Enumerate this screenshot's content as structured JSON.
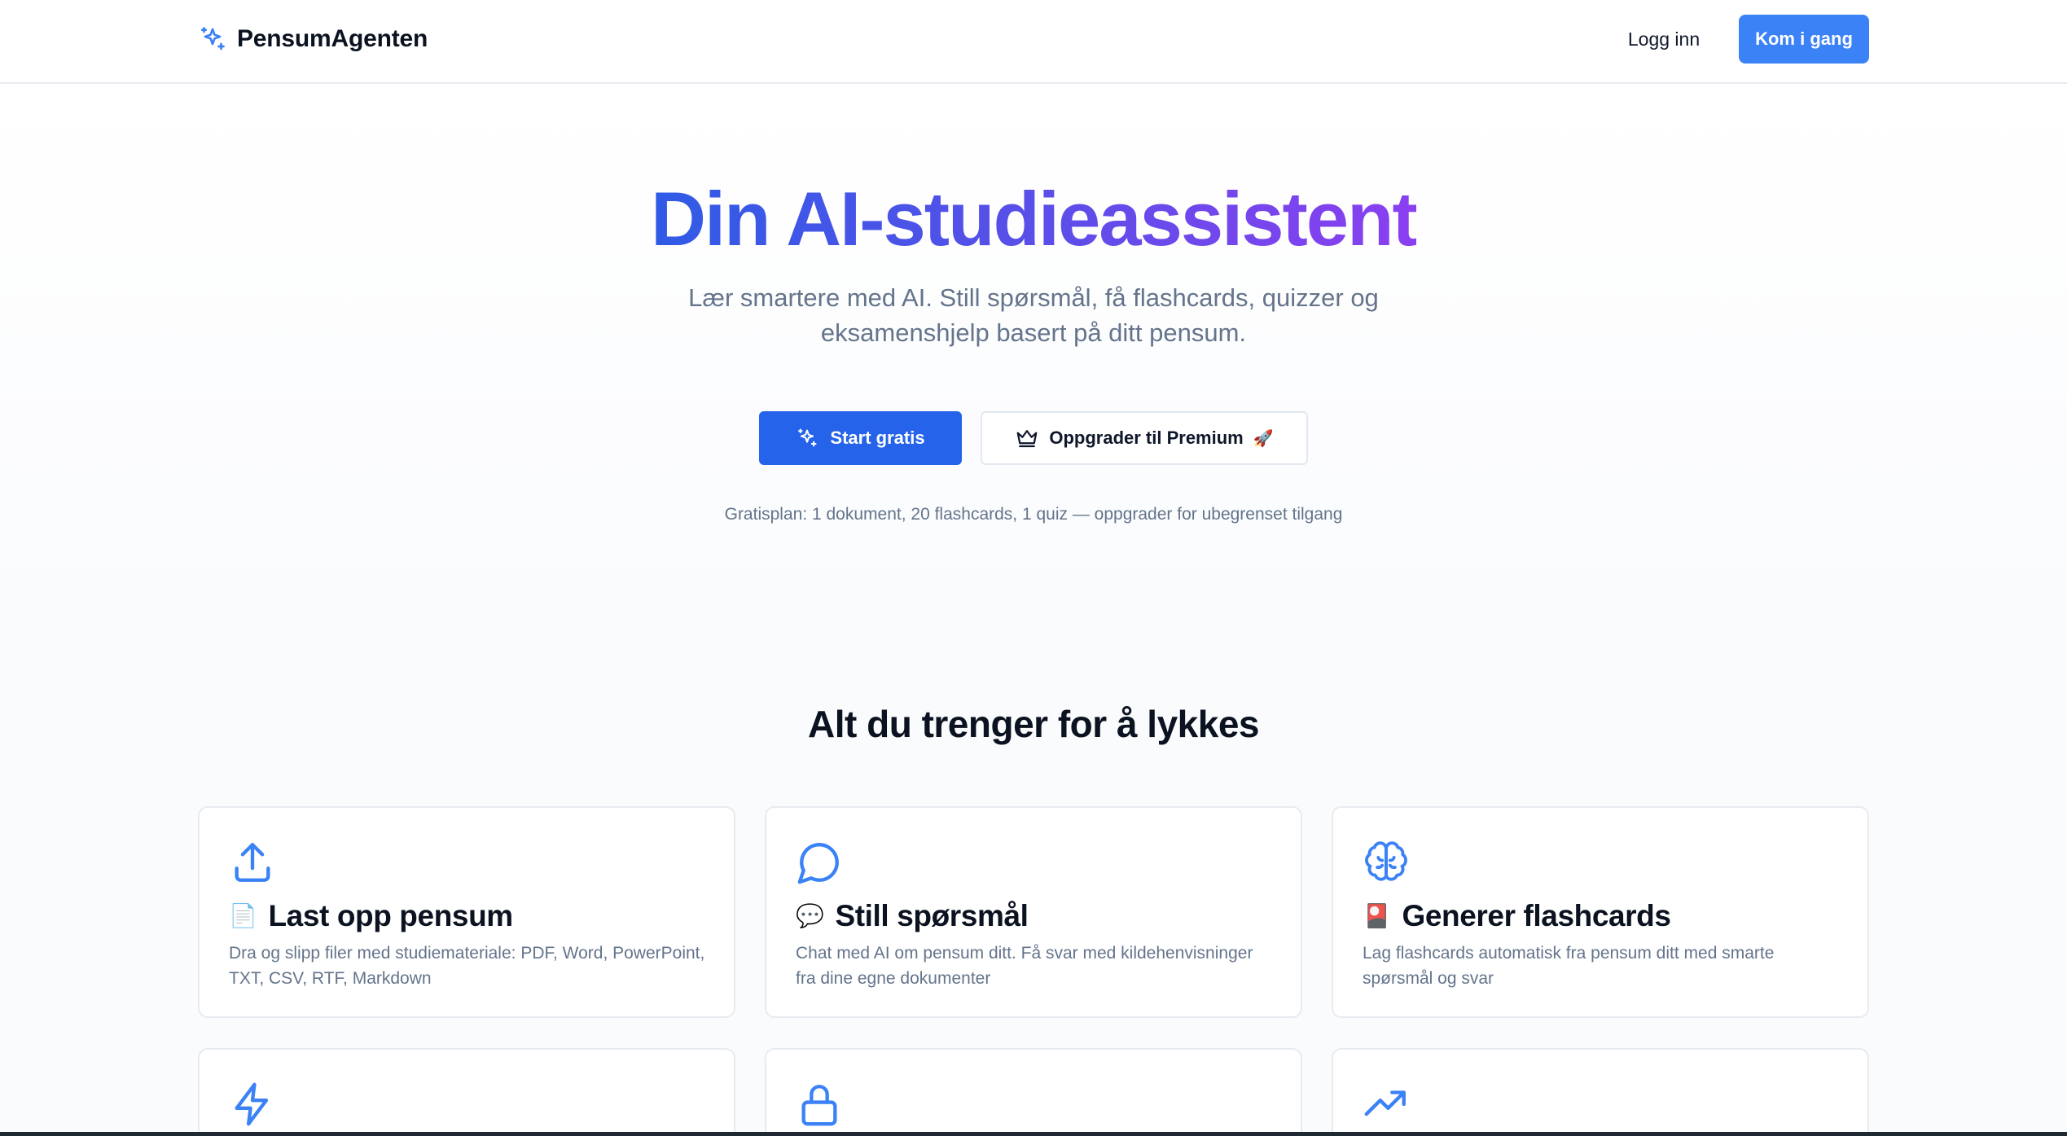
{
  "header": {
    "brand": "PensumAgenten",
    "login": "Logg inn",
    "get_started": "Kom i gang"
  },
  "hero": {
    "title": "Din AI-studieassistent",
    "subtitle": "Lær smartere med AI. Still spørsmål, få flashcards, quizzer og eksamenshjelp basert på ditt pensum.",
    "start_button": "Start gratis",
    "premium_button": "Oppgrader til Premium",
    "premium_emoji": "🚀",
    "plan_note": "Gratisplan: 1 dokument, 20 flashcards, 1 quiz — oppgrader for ubegrenset tilgang"
  },
  "features": {
    "title": "Alt du trenger for å lykkes",
    "cards": [
      {
        "icon": "upload-icon",
        "emoji": "📄",
        "title": "Last opp pensum",
        "description": "Dra og slipp filer med studiemateriale: PDF, Word, PowerPoint, TXT, CSV, RTF, Markdown"
      },
      {
        "icon": "chat-bubble-icon",
        "emoji": "💬",
        "title": "Still spørsmål",
        "description": "Chat med AI om pensum ditt. Få svar med kildehenvisninger fra dine egne dokumenter"
      },
      {
        "icon": "brain-icon",
        "emoji": "🎴",
        "title": "Generer flashcards",
        "description": "Lag flashcards automatisk fra pensum ditt med smarte spørsmål og svar"
      },
      {
        "icon": "lightning-icon"
      },
      {
        "icon": "lock-icon"
      },
      {
        "icon": "trending-up-icon"
      }
    ]
  },
  "colors": {
    "primary": "#2563eb",
    "accent": "#3b82f6",
    "gradient_start": "#2f5be6",
    "gradient_end": "#8b3ff0",
    "muted_text": "#64748b"
  }
}
